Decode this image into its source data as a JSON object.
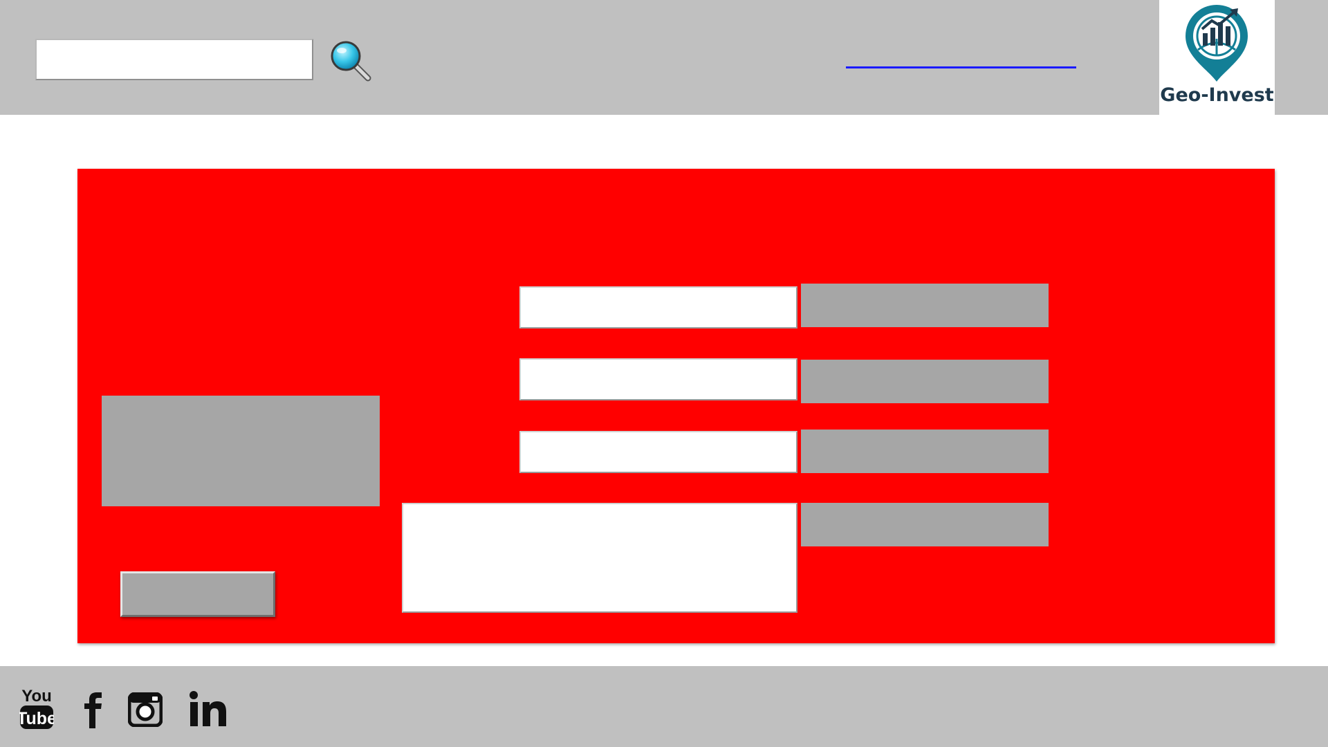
{
  "header": {
    "search": {
      "value": "",
      "placeholder": ""
    },
    "search_icon": "magnifier-icon",
    "link_text": "",
    "logo": {
      "text": "Geo-Invest",
      "icon": "location-pin-chart-icon",
      "colors": {
        "teal": "#137f96",
        "navy": "#1f3a4d"
      }
    }
  },
  "main": {
    "background_color": "#ff0000",
    "fields": [
      {
        "value": "",
        "label": ""
      },
      {
        "value": "",
        "label": ""
      },
      {
        "value": "",
        "label": ""
      }
    ],
    "textarea": {
      "value": "",
      "label": ""
    },
    "image_placeholder": "",
    "submit_label": ""
  },
  "footer": {
    "social": [
      {
        "name": "YouTube",
        "icon": "youtube-icon"
      },
      {
        "name": "Facebook",
        "icon": "facebook-icon"
      },
      {
        "name": "Instagram",
        "icon": "instagram-icon"
      },
      {
        "name": "LinkedIn",
        "icon": "linkedin-icon"
      }
    ]
  }
}
